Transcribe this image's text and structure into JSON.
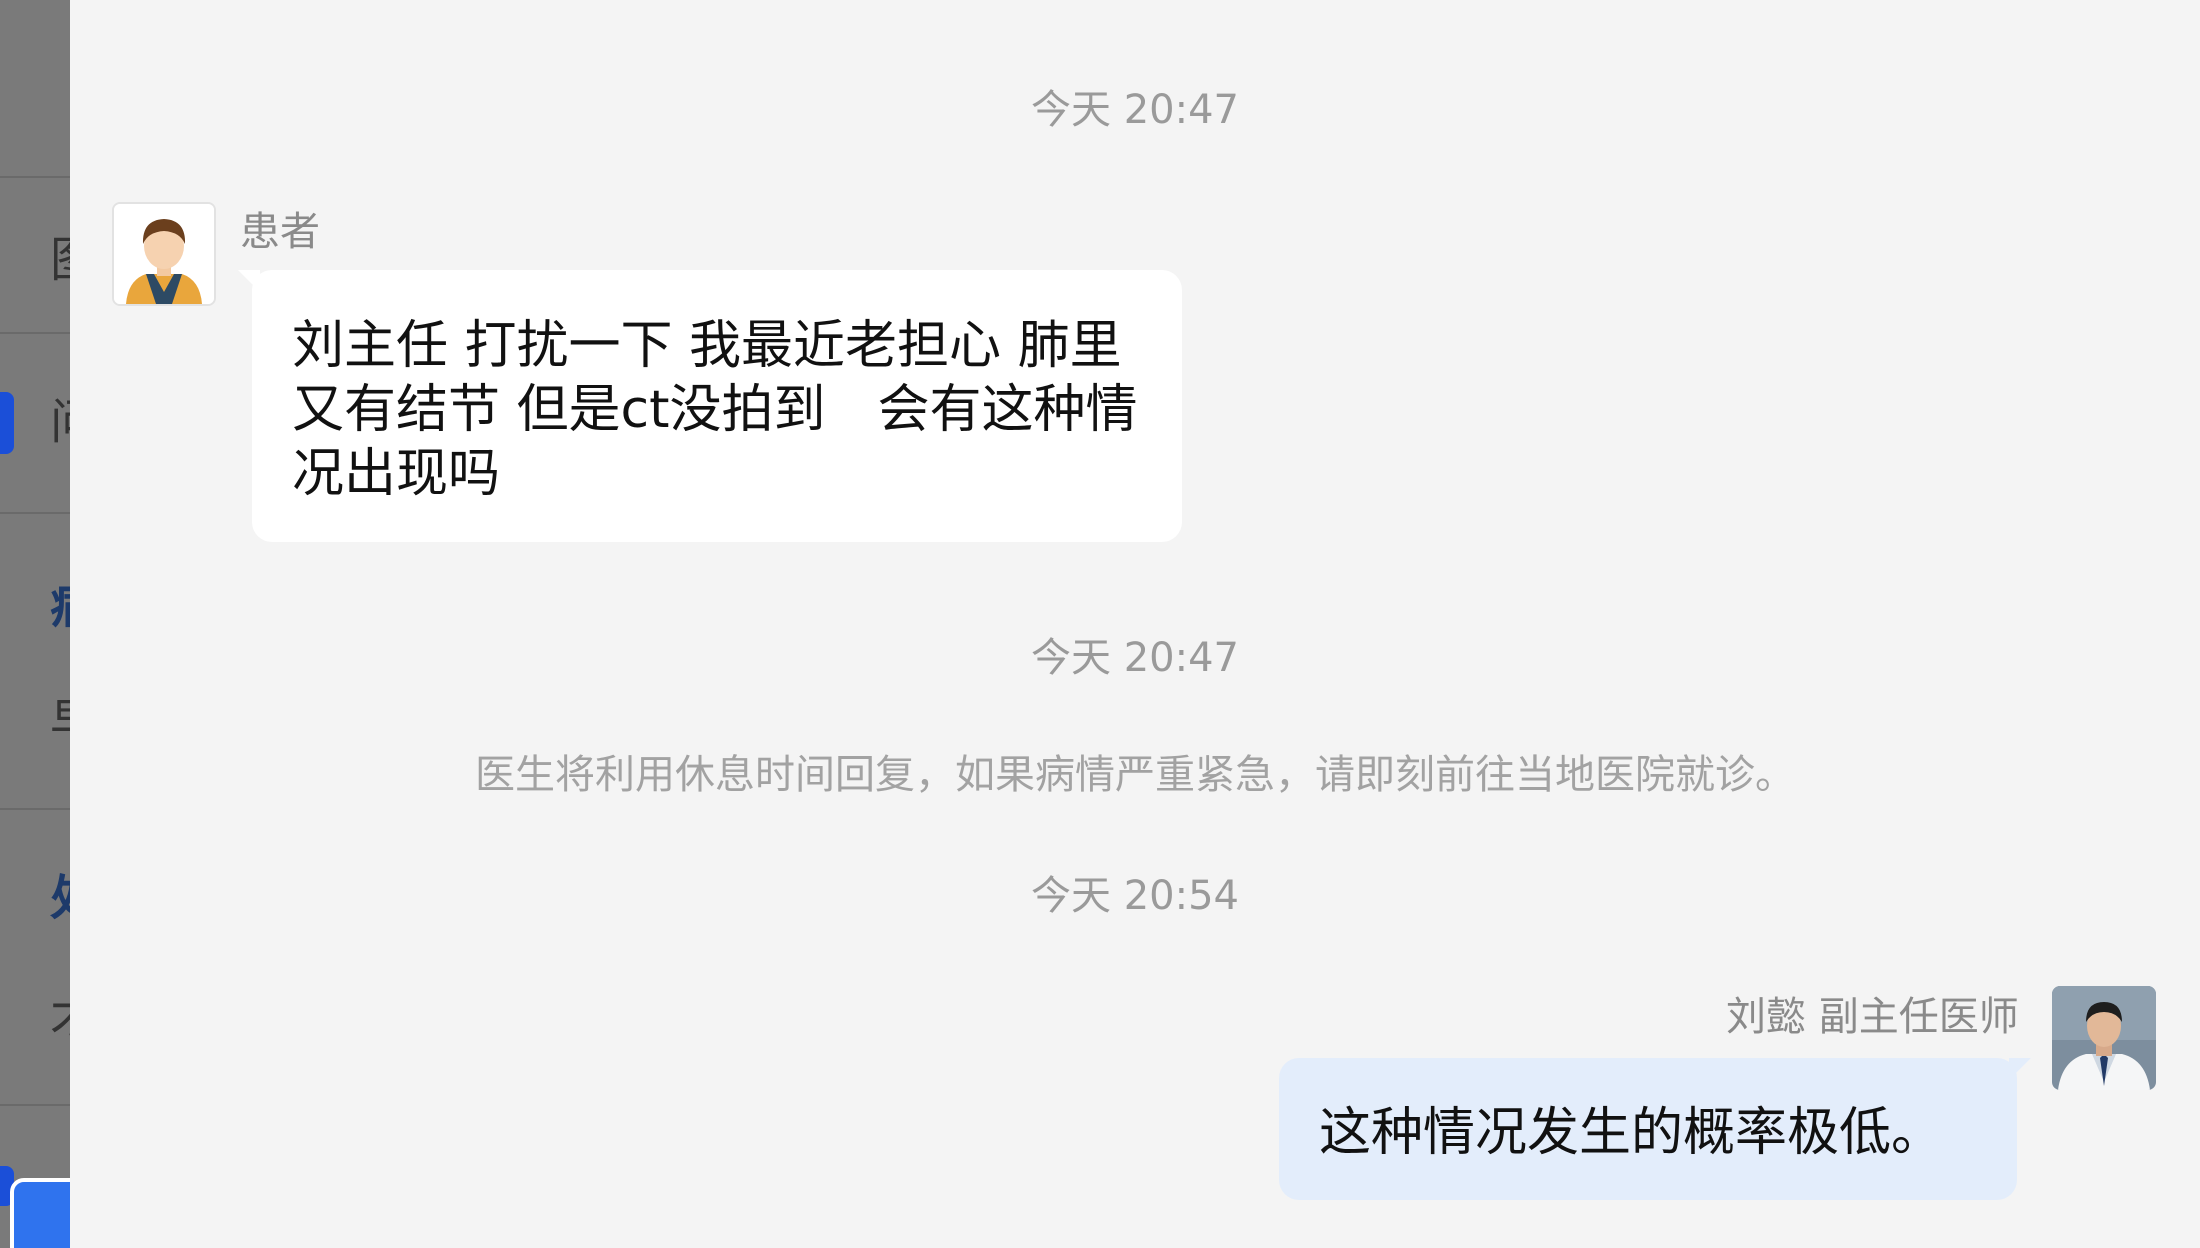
{
  "background_panel": {
    "fragments": [
      "图",
      "问",
      "病",
      "早",
      "处",
      "才"
    ]
  },
  "messages": [
    {
      "timestamp": "今天 20:47"
    },
    {
      "sender": "患者",
      "text": "刘主任 打扰一下 我最近老担心 肺里又有结节 但是ct没拍到　会有这种情况出现吗"
    },
    {
      "timestamp": "今天 20:47"
    },
    {
      "notice": "医生将利用休息时间回复，如果病情严重紧急，请即刻前往当地医院就诊。"
    },
    {
      "timestamp": "今天 20:54"
    },
    {
      "sender": "刘懿 副主任医师",
      "text": "这种情况发生的概率极低。"
    }
  ],
  "colors": {
    "page_background": "#f4f4f4",
    "patient_bubble": "#ffffff",
    "doctor_bubble": "#e3edfb",
    "meta_text": "#9a9a9a",
    "message_text": "#111111"
  },
  "icons": {
    "patient_avatar": "cartoon-person-avatar",
    "doctor_avatar": "doctor-photo-avatar"
  }
}
